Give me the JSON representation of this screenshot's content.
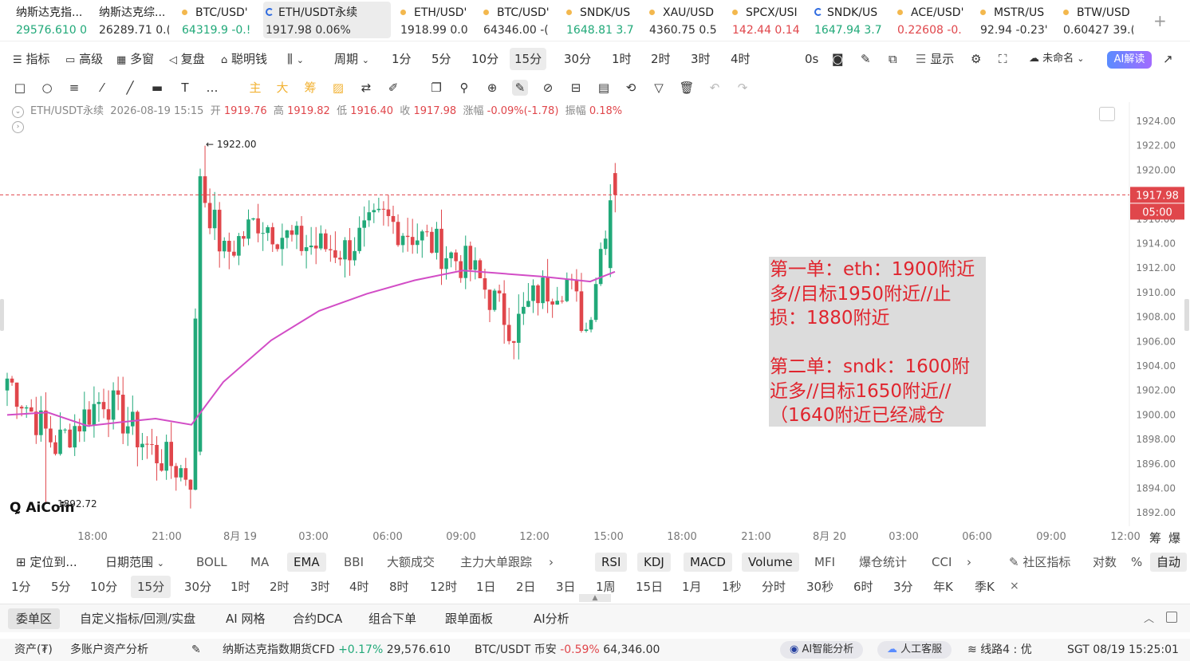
{
  "tickers": [
    {
      "name": "纳斯达克指...",
      "price": "29576.610 0",
      "dir": "up",
      "x": 20,
      "w": 88
    },
    {
      "name": "纳斯达克综...",
      "price": "26289.71 0.(",
      "dir": "dark",
      "x": 124,
      "w": 88
    },
    {
      "name": "BTC/USD'",
      "price": "64319.9 -0.!",
      "dir": "up",
      "x": 228,
      "w": 88,
      "icon": "dot"
    },
    {
      "name": "ETH/USDT永续",
      "price": "1917.98 0.06%",
      "dir": "dark",
      "x": 330,
      "w": 160,
      "icon": "ring",
      "active": true
    },
    {
      "name": "ETH/USD'",
      "price": "1918.99 0.0",
      "dir": "dark",
      "x": 502,
      "w": 88,
      "icon": "dot"
    },
    {
      "name": "BTC/USD'",
      "price": "64346.00 -(",
      "dir": "dark",
      "x": 606,
      "w": 88,
      "icon": "dot"
    },
    {
      "name": "SNDK/US",
      "price": "1648.81 3.7",
      "dir": "up",
      "x": 710,
      "w": 88,
      "icon": "dot"
    },
    {
      "name": "XAU/USD",
      "price": "4360.75 0.5",
      "dir": "dark",
      "x": 814,
      "w": 88,
      "icon": "dot"
    },
    {
      "name": "SPCX/USI",
      "price": "142.44 0.14",
      "dir": "dn",
      "x": 918,
      "w": 88,
      "icon": "dot"
    },
    {
      "name": "SNDK/US",
      "price": "1647.94 3.7",
      "dir": "up",
      "x": 1021,
      "w": 88,
      "icon": "ring"
    },
    {
      "name": "ACE/USD'",
      "price": "0.22608 -0.",
      "dir": "dn",
      "x": 1125,
      "w": 88,
      "icon": "dot"
    },
    {
      "name": "MSTR/US",
      "price": "92.94 -0.23'",
      "dir": "dark",
      "x": 1229,
      "w": 88,
      "icon": "dot"
    },
    {
      "name": "BTW/USD",
      "price": "0.60427 39.(",
      "dir": "dark",
      "x": 1333,
      "w": 88,
      "icon": "dot"
    }
  ],
  "toolbar": {
    "indicators": "指标",
    "advanced": "高级",
    "multi": "多窗",
    "replay": "复盘",
    "smart_money": "聪明钱",
    "period": "周期",
    "periods": [
      "1分",
      "5分",
      "10分",
      "15分",
      "30分",
      "1时",
      "2时",
      "3时",
      "4时"
    ],
    "countdown": "0s",
    "display": "显示",
    "account": "未命名",
    "ai_read": "AI解读"
  },
  "chart": {
    "info": {
      "symbol": "ETH/USDT永续",
      "datetime": "2026-08-19 15:15",
      "open_label": "开",
      "open": "1919.76",
      "high_label": "高",
      "high": "1919.82",
      "low_label": "低",
      "low": "1916.40",
      "close_label": "收",
      "close": "1917.98",
      "chg_label": "涨幅",
      "chg": "-0.09%(-1.78)",
      "amp_label": "振幅",
      "amp": "0.18%"
    },
    "y_ticks": [
      "1924.00",
      "1922.00",
      "1920.00",
      "1918.00",
      "1916.00",
      "1914.00",
      "1912.00",
      "1910.00",
      "1908.00",
      "1906.00",
      "1904.00",
      "1902.00",
      "1900.00",
      "1898.00",
      "1896.00",
      "1894.00",
      "1892.00"
    ],
    "x_ticks": [
      "18:00",
      "21:00",
      "8月 19",
      "03:00",
      "06:00",
      "09:00",
      "12:00",
      "15:00",
      "18:00",
      "21:00",
      "8月 20",
      "03:00",
      "06:00",
      "09:00",
      "12:00"
    ],
    "current_price": "1917.98",
    "countdown": "05:00",
    "high_mark": "← 1922.00",
    "low_mark": "1892.72",
    "logo": "AiCoin",
    "right_tools": [
      "筹",
      "爆"
    ],
    "note": "第一单：eth：1900附近多//目标1950附近//止损：1880附近\n\n第二单：sndk：1600附近多//目标1650附近//（1640附近已经减仓",
    "colors": {
      "up": "#21a979",
      "down": "#e0464b",
      "ema": "#d24dc6"
    }
  },
  "indicator_bar": {
    "locate": "定位到...",
    "date_range": "日期范围",
    "items": [
      "BOLL",
      "MA",
      "EMA",
      "BBI",
      "大额成交",
      "主力大单跟踪"
    ],
    "sub_items": [
      "RSI",
      "KDJ",
      "MACD",
      "Volume",
      "MFI",
      "爆仓统计",
      "CCI"
    ],
    "community": "社区指标",
    "log": "对数",
    "percent": "%",
    "auto": "自动"
  },
  "period_bar": [
    "1分",
    "5分",
    "10分",
    "15分",
    "30分",
    "1时",
    "2时",
    "3时",
    "4时",
    "8时",
    "12时",
    "1日",
    "2日",
    "3日",
    "1周",
    "15日",
    "1月",
    "1秒",
    "分时",
    "30秒",
    "6时",
    "3分",
    "年K",
    "季K"
  ],
  "tabs": [
    "委单区",
    "自定义指标/回测/实盘",
    "AI 网格",
    "合约DCA",
    "组合下单",
    "跟单面板",
    "AI分析"
  ],
  "status": {
    "assets": "资产(₮)",
    "multi_account": "多账户资产分析",
    "idx_name": "纳斯达克指数期货CFD",
    "idx_chg": "+0.17%",
    "idx_price": "29,576.610",
    "btc_name": "BTC/USDT 币安",
    "btc_chg": "-0.59%",
    "btc_price": "64,346.00",
    "ai_analysis": "AI智能分析",
    "service": "人工客服",
    "line": "线路4 : 优",
    "time": "SGT 08/19 15:25:01"
  }
}
